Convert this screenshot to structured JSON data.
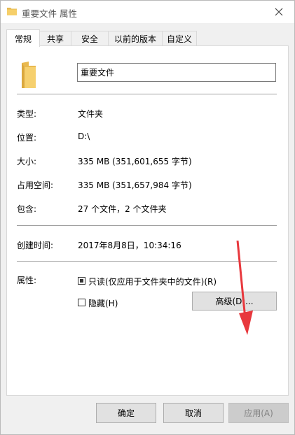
{
  "window": {
    "title": "重要文件 属性"
  },
  "tabs": [
    {
      "label": "常规"
    },
    {
      "label": "共享"
    },
    {
      "label": "安全"
    },
    {
      "label": "以前的版本"
    },
    {
      "label": "自定义"
    }
  ],
  "general": {
    "name_value": "重要文件",
    "rows": [
      {
        "label": "类型:",
        "value": "文件夹"
      },
      {
        "label": "位置:",
        "value": "D:\\"
      },
      {
        "label": "大小:",
        "value": "335 MB (351,601,655 字节)"
      },
      {
        "label": "占用空间:",
        "value": "335 MB (351,657,984 字节)"
      },
      {
        "label": "包含:",
        "value": "27 个文件，2 个文件夹"
      },
      {
        "label": "创建时间:",
        "value": "2017年8月8日，10:34:16"
      }
    ],
    "attributes": {
      "label": "属性:",
      "readonly": {
        "label": "只读(仅应用于文件夹中的文件)(R)",
        "checked": true
      },
      "hidden": {
        "label": "隐藏(H)",
        "checked": false
      },
      "advanced_label": "高级(D)..."
    }
  },
  "footer": {
    "ok_label": "确定",
    "cancel_label": "取消",
    "apply_label": "应用(A)",
    "apply_enabled": false
  },
  "colors": {
    "folder": "#f4c75e",
    "annotation_arrow": "#e8383d"
  }
}
